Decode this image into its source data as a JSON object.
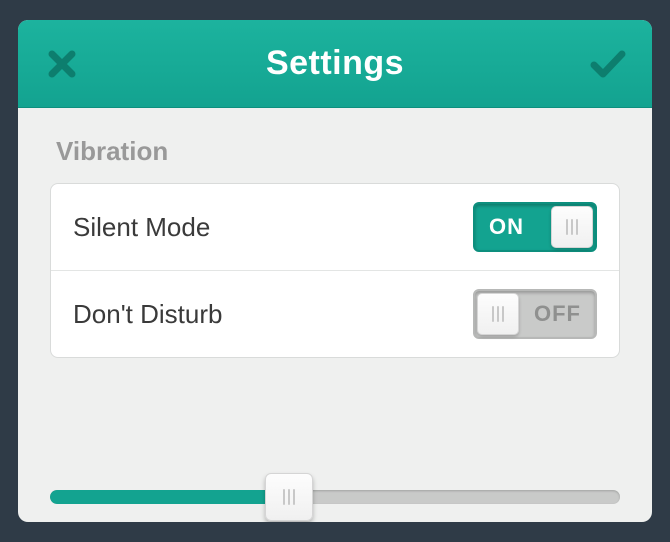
{
  "header": {
    "title": "Settings"
  },
  "section": {
    "label": "Vibration"
  },
  "rows": [
    {
      "label": "Silent Mode",
      "state": "on",
      "text": "ON"
    },
    {
      "label": "Don't Disturb",
      "state": "off",
      "text": "OFF"
    }
  ],
  "slider": {
    "value": 42
  },
  "colors": {
    "accent": "#13a390",
    "background": "#2f3b47"
  }
}
